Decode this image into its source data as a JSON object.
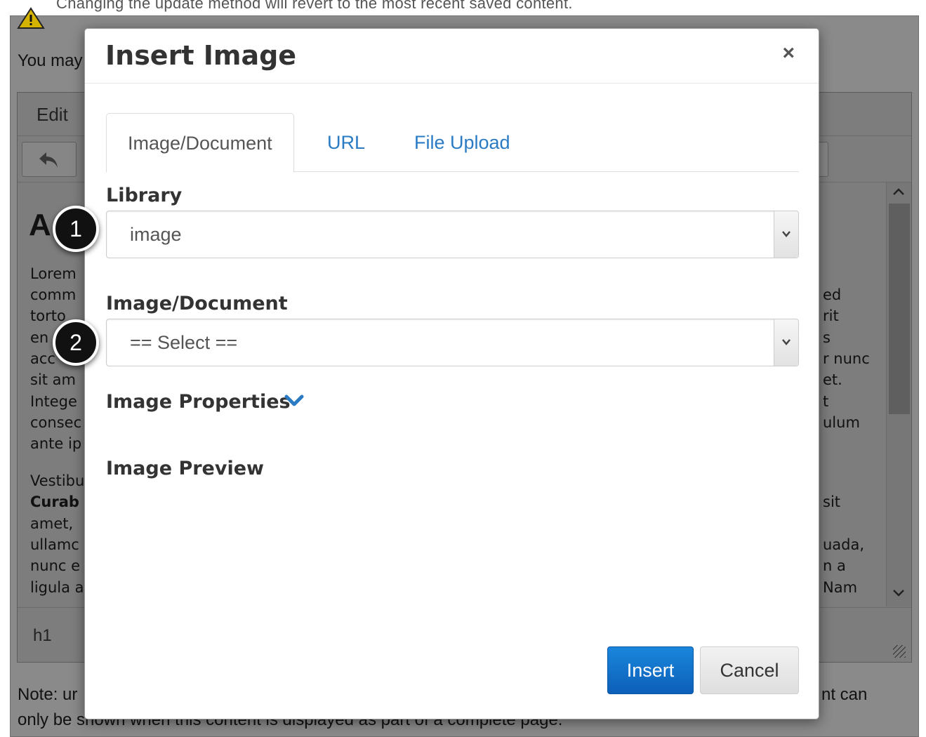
{
  "background": {
    "warning_text": "Changing the update method will revert to the most recent saved content.",
    "you_may_text": "You may",
    "menu_edit": "Edit",
    "heading_fragment": "A",
    "content_left": [
      "Lorem",
      "comm",
      "torto",
      "en",
      "acc",
      "sit am",
      "Intege",
      "consec",
      "ante ip"
    ],
    "content_left_p2": [
      "Vestibu",
      "Curab",
      "amet,",
      "ullamc",
      "nunc e",
      "ligula a"
    ],
    "content_right": [
      "ed",
      "rit",
      "s",
      "r nunc",
      "et.",
      "t",
      "ulum"
    ],
    "content_right_p2": [
      "sit",
      "uada,",
      "n a",
      "Nam"
    ],
    "status_path": "h1",
    "note_left": "Note: ur",
    "note_right": "nt can",
    "note_line2": "only be shown when this content is displayed as part of a complete page."
  },
  "modal": {
    "title": "Insert Image",
    "close_symbol": "×",
    "tabs": [
      {
        "label": "Image/Document",
        "active": true
      },
      {
        "label": "URL",
        "active": false
      },
      {
        "label": "File Upload",
        "active": false
      }
    ],
    "library": {
      "label": "Library",
      "value": "image"
    },
    "document": {
      "label": "Image/Document",
      "value": "== Select =="
    },
    "properties_label": "Image Properties",
    "preview_label": "Image Preview",
    "insert_label": "Insert",
    "cancel_label": "Cancel"
  },
  "markers": [
    "1",
    "2"
  ],
  "colors": {
    "accent": "#2a7bc4",
    "insert_button": "#1477d1",
    "overlay": "#8a8a8a"
  },
  "icons": {
    "warning": "warning-icon",
    "undo": "undo-icon",
    "chevron": "chevron-down-icon",
    "close": "close-icon"
  }
}
